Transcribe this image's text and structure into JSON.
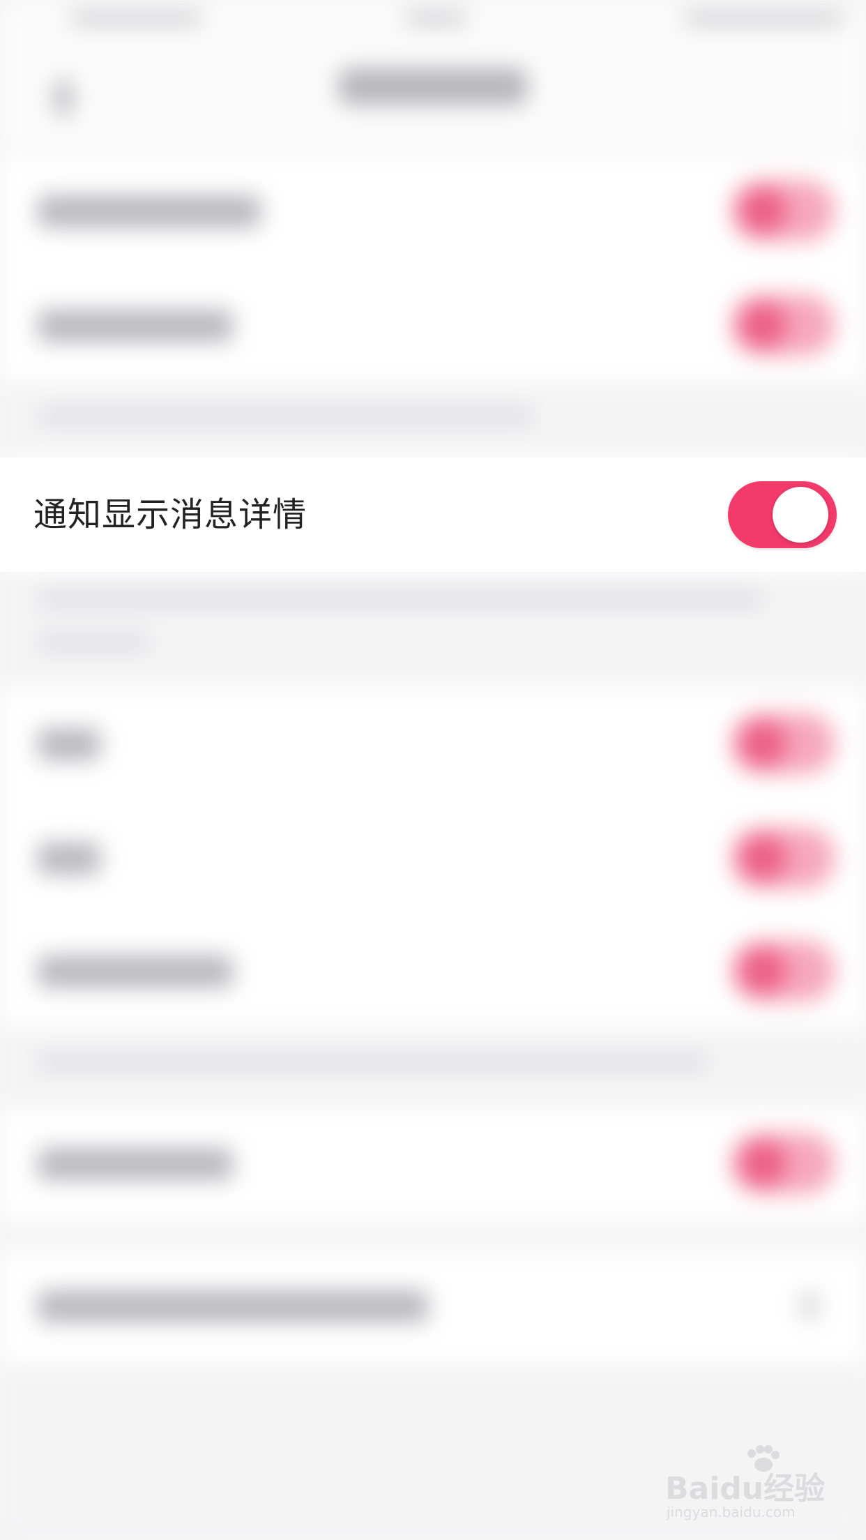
{
  "setting": {
    "label": "通知显示消息详情",
    "enabled": true
  },
  "colors": {
    "toggle_on": "#f23a6b",
    "background": "#f4f4f5",
    "row_background": "#ffffff",
    "text": "#222222"
  },
  "watermark": {
    "brand": "Baidu经验",
    "url": "jingyan.baidu.com"
  }
}
